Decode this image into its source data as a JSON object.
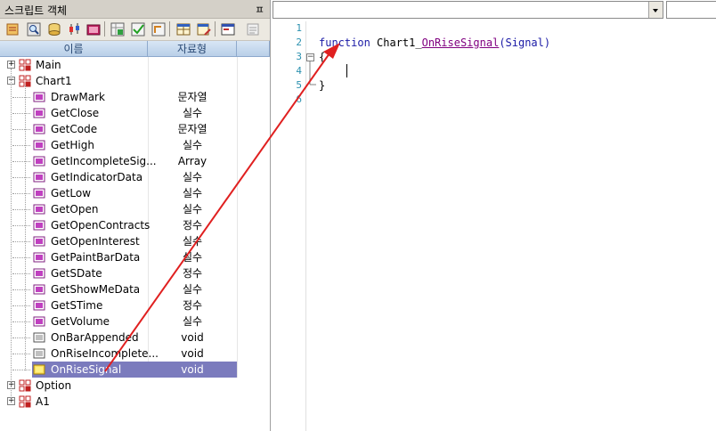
{
  "panel": {
    "title": "스크립트 객체",
    "pin_glyph": "ㅍ"
  },
  "toolbar": {
    "buttons": [
      "new-script-icon",
      "find-icon",
      "database-icon",
      "chart-candle-icon",
      "compile-icon",
      "grid-add-icon",
      "grid-check-icon",
      "grid-arrow-icon",
      "table-icon",
      "table-edit-icon",
      "window-icon",
      "list-icon"
    ]
  },
  "columns": {
    "name": "이름",
    "type": "자료형"
  },
  "tree": [
    {
      "label": "Main",
      "type": "",
      "level": 0,
      "expander": "+",
      "icon": "object-icon"
    },
    {
      "label": "Chart1",
      "type": "",
      "level": 0,
      "expander": "−",
      "icon": "object-icon"
    },
    {
      "label": "DrawMark",
      "type": "문자열",
      "level": 1,
      "icon": "method-icon"
    },
    {
      "label": "GetClose",
      "type": "실수",
      "level": 1,
      "icon": "method-icon"
    },
    {
      "label": "GetCode",
      "type": "문자열",
      "level": 1,
      "icon": "method-icon"
    },
    {
      "label": "GetHigh",
      "type": "실수",
      "level": 1,
      "icon": "method-icon"
    },
    {
      "label": "GetIncompleteSig...",
      "type": "Array",
      "level": 1,
      "icon": "method-icon"
    },
    {
      "label": "GetIndicatorData",
      "type": "실수",
      "level": 1,
      "icon": "method-icon"
    },
    {
      "label": "GetLow",
      "type": "실수",
      "level": 1,
      "icon": "method-icon"
    },
    {
      "label": "GetOpen",
      "type": "실수",
      "level": 1,
      "icon": "method-icon"
    },
    {
      "label": "GetOpenContracts",
      "type": "정수",
      "level": 1,
      "icon": "method-icon"
    },
    {
      "label": "GetOpenInterest",
      "type": "실수",
      "level": 1,
      "icon": "method-icon"
    },
    {
      "label": "GetPaintBarData",
      "type": "실수",
      "level": 1,
      "icon": "method-icon"
    },
    {
      "label": "GetSDate",
      "type": "정수",
      "level": 1,
      "icon": "method-icon"
    },
    {
      "label": "GetShowMeData",
      "type": "실수",
      "level": 1,
      "icon": "method-icon"
    },
    {
      "label": "GetSTime",
      "type": "정수",
      "level": 1,
      "icon": "method-icon"
    },
    {
      "label": "GetVolume",
      "type": "실수",
      "level": 1,
      "icon": "method-icon"
    },
    {
      "label": "OnBarAppended",
      "type": "void",
      "level": 1,
      "icon": "event-icon"
    },
    {
      "label": "OnRiseIncomplete...",
      "type": "void",
      "level": 1,
      "icon": "event-icon"
    },
    {
      "label": "OnRiseSignal",
      "type": "void",
      "level": 1,
      "icon": "event-selected-icon",
      "selected": true
    },
    {
      "label": "Option",
      "type": "",
      "level": 0,
      "expander": "+",
      "icon": "object-icon"
    },
    {
      "label": "A1",
      "type": "",
      "level": 0,
      "expander": "+",
      "icon": "object-icon"
    }
  ],
  "editor": {
    "object_combo": "",
    "event_combo": "",
    "line_numbers": [
      "1",
      "2",
      "3",
      "4",
      "5",
      "6"
    ],
    "line2": {
      "keyword": "function",
      "prefix": "Chart1_",
      "name": "OnRiseSignal",
      "params": "(Signal)"
    },
    "line3": "{",
    "line5": "}"
  },
  "colors": {
    "keyword": "#1a1aa6",
    "function_name": "#800080",
    "line_number": "#2b91af",
    "selection": "#7b7bbd",
    "annotation_arrow": "#e02020"
  }
}
